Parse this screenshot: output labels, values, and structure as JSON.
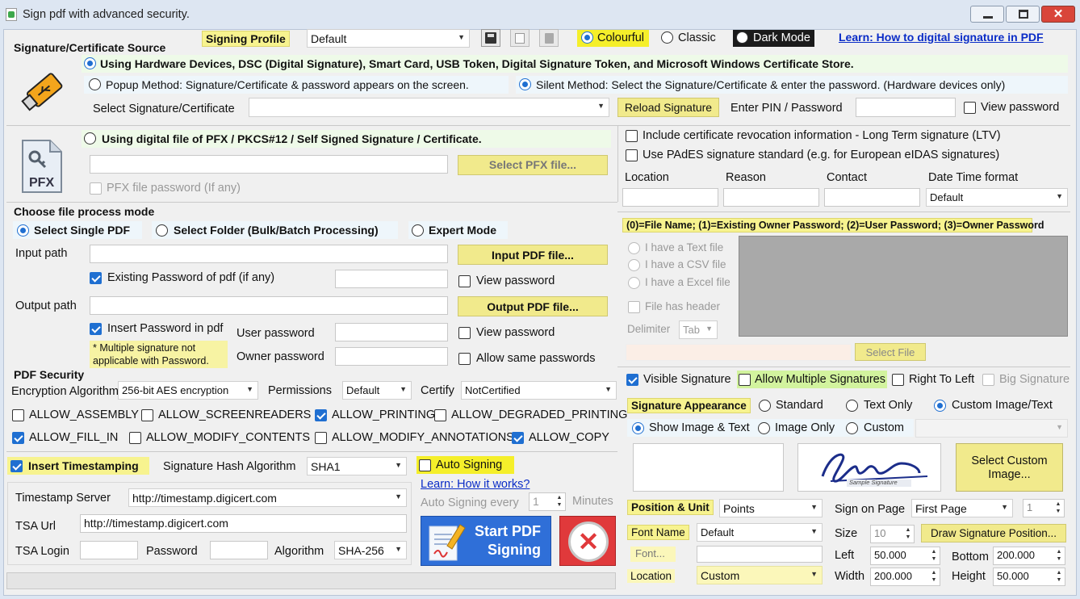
{
  "window": {
    "title": "Sign pdf with advanced security."
  },
  "source": {
    "heading": "Signature/Certificate Source",
    "hardware": "Using Hardware Devices, DSC (Digital Signature), Smart Card, USB Token, Digital Signature Token, and Microsoft Windows Certificate Store.",
    "popup": "Popup Method: Signature/Certificate & password appears on the screen.",
    "silent": "Silent Method: Select the Signature/Certificate & enter the password. (Hardware devices only)",
    "select_label": "Select Signature/Certificate",
    "reload": "Reload Signature",
    "pin_label": "Enter PIN / Password",
    "view_password": "View password",
    "pfx_option": "Using digital file of PFX / PKCS#12 / Self Signed Signature / Certificate.",
    "pfx_button": "Select PFX file...",
    "pfx_password": "PFX file password (If any)",
    "pfx_icon_text": "PFX"
  },
  "profile": {
    "label": "Signing Profile",
    "value": "Default"
  },
  "theme": {
    "colourful": "Colourful",
    "classic": "Classic",
    "dark": "Dark Mode"
  },
  "learn_link": "Learn: How to digital signature in PDF",
  "ltv": {
    "revocation": "Include certificate revocation information - Long Term signature (LTV)",
    "pades": "Use PAdES signature standard (e.g. for European eIDAS signatures)"
  },
  "meta": {
    "location": "Location",
    "reason": "Reason",
    "contact": "Contact",
    "datetime": "Date Time format",
    "datetime_value": "Default"
  },
  "bulk": {
    "legend": "(0)=File Name; (1)=Existing Owner Password; (2)=User Password; (3)=Owner Password",
    "text": "I have a Text file",
    "csv": "I have a CSV file",
    "excel": "I have a Excel file",
    "header": "File has header",
    "delimiter": "Delimiter",
    "delimiter_value": "Tab",
    "select_file": "Select File"
  },
  "process": {
    "heading": "Choose file process mode",
    "single": "Select Single PDF",
    "folder": "Select Folder (Bulk/Batch Processing)",
    "expert": "Expert Mode",
    "input_path": "Input path",
    "input_button": "Input PDF file...",
    "existing_password": "Existing Password of pdf (if any)",
    "view_password": "View password",
    "output_path": "Output path",
    "output_button": "Output PDF file...",
    "insert_password": "Insert Password in pdf",
    "user_password": "User password",
    "owner_password": "Owner password",
    "view_password2": "View password",
    "allow_same": "Allow same passwords",
    "note": "* Multiple signature not applicable with Password."
  },
  "security": {
    "heading": "PDF Security",
    "enc_label": "Encryption Algorithm",
    "enc_value": "256-bit AES encryption",
    "perm_label": "Permissions",
    "perm_value": "Default",
    "certify_label": "Certify",
    "certify_value": "NotCertified",
    "perms": [
      "ALLOW_ASSEMBLY",
      "ALLOW_SCREENREADERS",
      "ALLOW_PRINTING",
      "ALLOW_DEGRADED_PRINTING",
      "ALLOW_FILL_IN",
      "ALLOW_MODIFY_CONTENTS",
      "ALLOW_MODIFY_ANNOTATIONS",
      "ALLOW_COPY"
    ]
  },
  "timestamp": {
    "insert": "Insert Timestamping",
    "hash_label": "Signature Hash Algorithm",
    "hash_value": "SHA1",
    "server_label": "Timestamp Server",
    "server_value": "http://timestamp.digicert.com",
    "url_label": "TSA Url",
    "url_value": "http://timestamp.digicert.com",
    "login_label": "TSA Login",
    "password_label": "Password",
    "algo_label": "Algorithm",
    "algo_value": "SHA-256"
  },
  "auto": {
    "label": "Auto Signing",
    "learn": "Learn: How it works?",
    "every": "Auto Signing every",
    "value": "1",
    "minutes": "Minutes"
  },
  "start": {
    "line1": "Start PDF",
    "line2": "Signing"
  },
  "visible": {
    "visible": "Visible Signature",
    "multiple": "Allow Multiple Signatures",
    "rtl": "Right To Left",
    "big": "Big Signature"
  },
  "appearance": {
    "label": "Signature Appearance",
    "standard": "Standard",
    "text_only": "Text Only",
    "custom_image_text": "Custom Image/Text",
    "show_image_text": "Show Image & Text",
    "image_only": "Image Only",
    "custom": "Custom",
    "sample_text": "Sample Signature",
    "select_custom": "Select Custom Image..."
  },
  "position": {
    "label": "Position & Unit",
    "unit": "Points",
    "sign_on_page": "Sign on Page",
    "page_value": "First Page",
    "page_num": "1",
    "font_name": "Font Name",
    "font_value": "Default",
    "font_btn": "Font...",
    "size_label": "Size",
    "size_value": "10",
    "draw": "Draw Signature Position...",
    "left_label": "Left",
    "left_value": "50.000",
    "bottom_label": "Bottom",
    "bottom_value": "200.000",
    "location_label": "Location",
    "location_value": "Custom",
    "width_label": "Width",
    "width_value": "200.000",
    "height_label": "Height",
    "height_value": "50.000"
  },
  "colors": {
    "accent": "#1f6fd1",
    "button_yellow": "#f1ea8c",
    "highlight": "#f7f38f",
    "green_highlight": "#d2f39e",
    "start_blue": "#2f6fd8",
    "cancel_red": "#e0393b"
  }
}
